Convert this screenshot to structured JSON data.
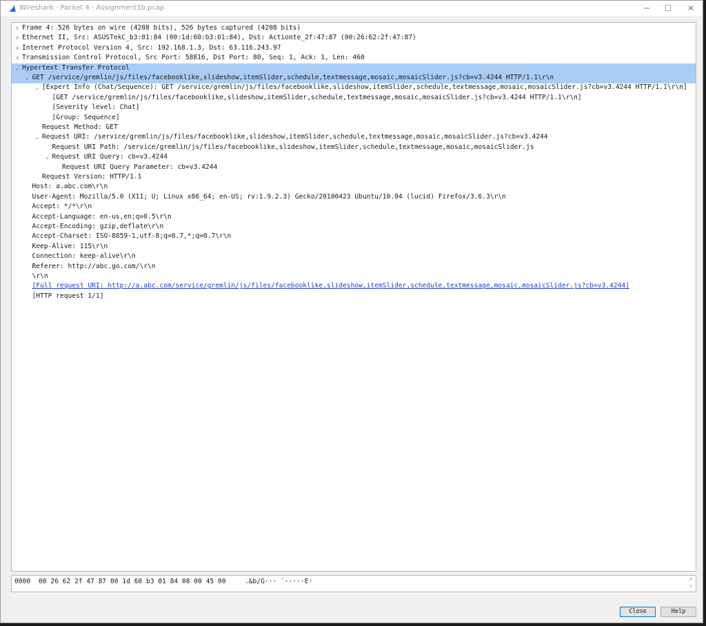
{
  "window": {
    "title": "Wireshark · Packet 4 · Assignment1b.pcap",
    "minimize_glyph": "─",
    "maximize_glyph": "☐",
    "close_glyph": "✕"
  },
  "tree": [
    {
      "arrow": ">",
      "text": "Frame 4: 526 bytes on wire (4208 bits), 526 bytes captured (4208 bits)"
    },
    {
      "arrow": ">",
      "text": "Ethernet II, Src: ASUSTekC_b3:01:84 (00:1d:60:b3:01:84), Dst: Actionte_2f:47:87 (00:26:62:2f:47:87)"
    },
    {
      "arrow": ">",
      "text": "Internet Protocol Version 4, Src: 192.168.1.3, Dst: 63.116.243.97"
    },
    {
      "arrow": ">",
      "text": "Transmission Control Protocol, Src Port: 58816, Dst Port: 80, Seq: 1, Ack: 1, Len: 460"
    },
    {
      "arrow": "v",
      "text": "Hypertext Transfer Protocol"
    },
    {
      "arrow": "v",
      "text": "GET /service/gremlin/js/files/facebooklike,slideshow,itemSlider,schedule,textmessage,mosaic,mosaicSlider.js?cb=v3.4244 HTTP/1.1\\r\\n"
    },
    {
      "arrow": "v",
      "text": "[Expert Info (Chat/Sequence): GET /service/gremlin/js/files/facebooklike,slideshow,itemSlider,schedule,textmessage,mosaic,mosaicSlider.js?cb=v3.4244 HTTP/1.1\\r\\n]"
    },
    {
      "arrow": "",
      "text": "[GET /service/gremlin/js/files/facebooklike,slideshow,itemSlider,schedule,textmessage,mosaic,mosaicSlider.js?cb=v3.4244 HTTP/1.1\\r\\n]"
    },
    {
      "arrow": "",
      "text": "[Severity level: Chat]"
    },
    {
      "arrow": "",
      "text": "[Group: Sequence]"
    },
    {
      "arrow": "",
      "text": "Request Method: GET"
    },
    {
      "arrow": "v",
      "text": "Request URI: /service/gremlin/js/files/facebooklike,slideshow,itemSlider,schedule,textmessage,mosaic,mosaicSlider.js?cb=v3.4244"
    },
    {
      "arrow": "",
      "text": "Request URI Path: /service/gremlin/js/files/facebooklike,slideshow,itemSlider,schedule,textmessage,mosaic,mosaicSlider.js"
    },
    {
      "arrow": "v",
      "text": "Request URI Query: cb=v3.4244"
    },
    {
      "arrow": "",
      "text": "Request URI Query Parameter: cb=v3.4244"
    },
    {
      "arrow": "",
      "text": "Request Version: HTTP/1.1"
    },
    {
      "arrow": "",
      "text": "Host: a.abc.com\\r\\n"
    },
    {
      "arrow": "",
      "text": "User-Agent: Mozilla/5.0 (X11; U; Linux x86_64; en-US; rv:1.9.2.3) Gecko/20100423 Ubuntu/10.04 (lucid) Firefox/3.6.3\\r\\n"
    },
    {
      "arrow": "",
      "text": "Accept: */*\\r\\n"
    },
    {
      "arrow": "",
      "text": "Accept-Language: en-us,en;q=0.5\\r\\n"
    },
    {
      "arrow": "",
      "text": "Accept-Encoding: gzip,deflate\\r\\n"
    },
    {
      "arrow": "",
      "text": "Accept-Charset: ISO-8859-1,utf-8;q=0.7,*;q=0.7\\r\\n"
    },
    {
      "arrow": "",
      "text": "Keep-Alive: 115\\r\\n"
    },
    {
      "arrow": "",
      "text": "Connection: keep-alive\\r\\n"
    },
    {
      "arrow": "",
      "text": "Referer: http://abc.go.com/\\r\\n"
    },
    {
      "arrow": "",
      "text": "\\r\\n"
    },
    {
      "arrow": "",
      "text": "[Full request URI: http://a.abc.com/service/gremlin/js/files/facebooklike,slideshow,itemSlider,schedule,textmessage,mosaic,mosaicSlider.js?cb=v3.4244]"
    },
    {
      "arrow": "",
      "text": "[HTTP request 1/1]"
    }
  ],
  "hex": {
    "offset": "0000",
    "bytes": "00 26 62 2f 47 87 00 1d  60 b3 01 84 08 00 45 00",
    "ascii": ".&b/G···  `·····E·",
    "scroll_up": "˄",
    "scroll_down": "˅"
  },
  "buttons": {
    "close": "Close",
    "help": "Help"
  },
  "colors": {
    "selection": "#a9cdf7",
    "link": "#1a3fd4",
    "accent": "#0078d7"
  },
  "icons": {
    "app": "wireshark-fin-icon",
    "expand": "chevron-right-icon",
    "collapse": "chevron-down-icon"
  }
}
